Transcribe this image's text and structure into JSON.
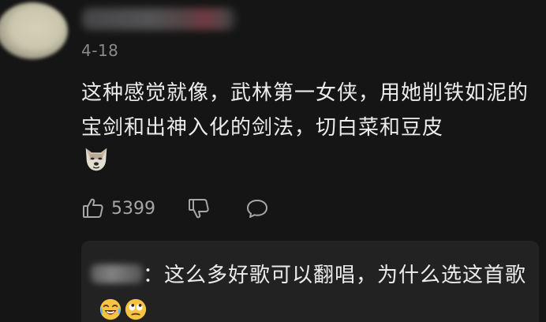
{
  "comment": {
    "date": "4-18",
    "text": "这种感觉就像，武林第一女侠，用她削铁如泥的宝剑和出神入化的剑法，切白菜和豆皮",
    "emoji": "dog-face-emoji",
    "like_count": "5399"
  },
  "reply": {
    "separator": "：",
    "text": "这么多好歌可以翻唱，为什么选这首歌",
    "emojis": [
      "crying-laughing-emoji",
      "eye-roll-emoji"
    ]
  },
  "icons": {
    "like": "thumbs-up-icon",
    "dislike": "thumbs-down-icon",
    "reply": "comment-bubble-icon"
  },
  "colors": {
    "background": "#151515",
    "text": "#ececec",
    "muted": "#8a8a8a",
    "reply_box": "#222222"
  }
}
